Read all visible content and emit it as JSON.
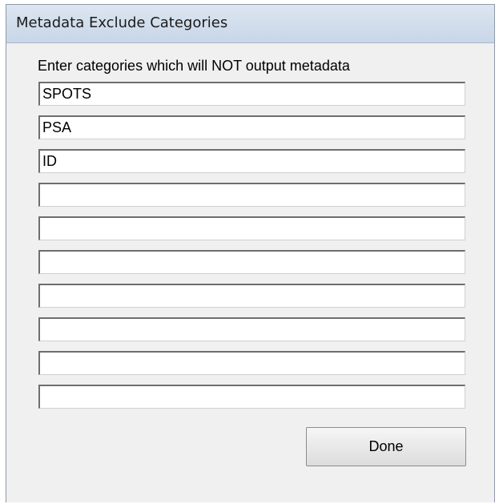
{
  "window": {
    "title": "Metadata Exclude Categories"
  },
  "form": {
    "prompt": "Enter categories which will NOT output metadata",
    "categories": [
      "SPOTS",
      "PSA",
      "ID",
      "",
      "",
      "",
      "",
      "",
      "",
      ""
    ]
  },
  "actions": {
    "done_label": "Done"
  }
}
